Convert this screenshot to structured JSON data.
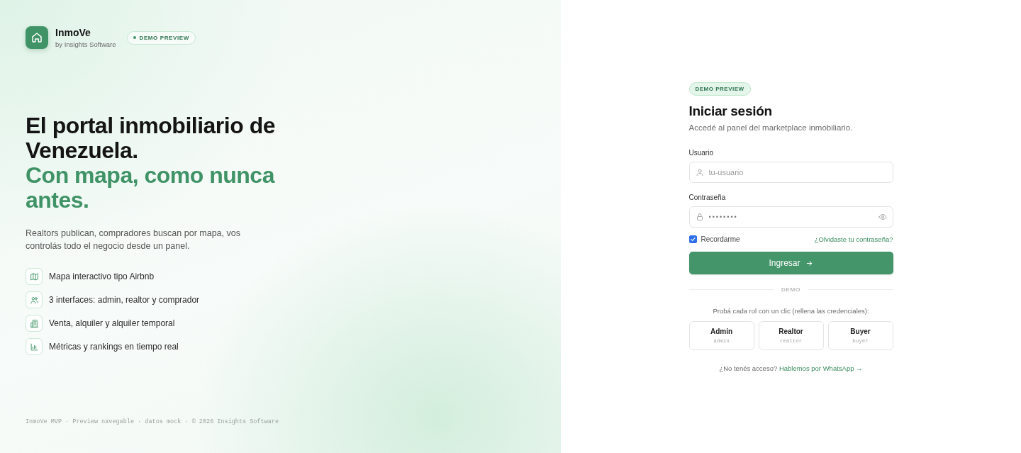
{
  "brand": {
    "name": "InmoVe",
    "byline": "by Insights Software",
    "badge": "DEMO PREVIEW"
  },
  "hero": {
    "headline": "El portal inmobiliario de Venezuela.",
    "headline_accent": "Con mapa, como nunca antes.",
    "description": "Realtors publican, compradores buscan por mapa, vos controlás todo el negocio desde un panel.",
    "features": [
      {
        "label": "Mapa interactivo tipo Airbnb"
      },
      {
        "label": "3 interfaces: admin, realtor y comprador"
      },
      {
        "label": "Venta, alquiler y alquiler temporal"
      },
      {
        "label": "Métricas y rankings en tiempo real"
      }
    ]
  },
  "footer": "InmoVe MVP · Preview navegable · datos mock · © 2026 Insights Software",
  "login": {
    "badge": "DEMO PREVIEW",
    "title": "Iniciar sesión",
    "subtitle": "Accedé al panel del marketplace inmobiliario.",
    "fields": [
      {
        "kind": "text",
        "label": "Usuario",
        "placeholder": "tu-usuario"
      },
      {
        "kind": "password",
        "label": "Contraseña",
        "value": "••••••••"
      }
    ],
    "remember": {
      "label": "Recordarme",
      "checked": true
    },
    "forgot_link": "¿Olvidaste tu contraseña?",
    "submit": "Ingresar",
    "divider": "DEMO",
    "demo_prompt": "Probá cada rol con un clic (rellena las credenciales):",
    "roles": [
      {
        "name": "Admin",
        "username": "admin"
      },
      {
        "name": "Realtor",
        "username": "realtor"
      },
      {
        "name": "Buyer",
        "username": "buyer"
      }
    ],
    "help_text": "¿No tenés acceso?",
    "help_link": "Hablemos por WhatsApp →"
  }
}
